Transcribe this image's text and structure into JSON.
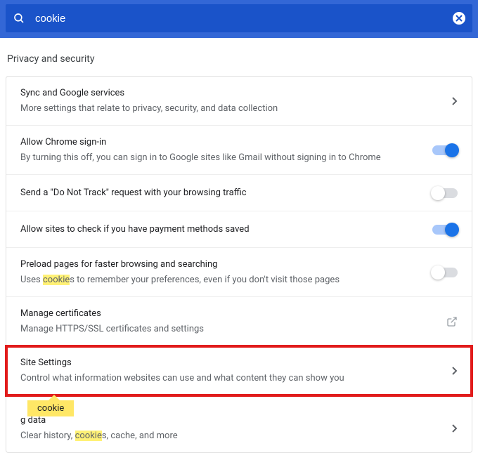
{
  "search": {
    "value": "cookie"
  },
  "section_title": "Privacy and security",
  "tooltip_text": "cookie",
  "rows": [
    {
      "title": "Sync and Google services",
      "desc": "More settings that relate to privacy, security, and data collection"
    },
    {
      "title": "Allow Chrome sign-in",
      "desc": "By turning this off, you can sign in to Google sites like Gmail without signing in to Chrome"
    },
    {
      "title": "Send a \"Do Not Track\" request with your browsing traffic"
    },
    {
      "title": "Allow sites to check if you have payment methods saved"
    },
    {
      "title": "Preload pages for faster browsing and searching",
      "desc_pre": "Uses ",
      "desc_hl": "cookie",
      "desc_post": "s to remember your preferences, even if you don't visit those pages"
    },
    {
      "title": "Manage certificates",
      "desc": "Manage HTTPS/SSL certificates and settings"
    },
    {
      "title": "Site Settings",
      "desc": "Control what information websites can use and what content they can show you"
    },
    {
      "title_post": "g data",
      "desc_pre": "Clear history, ",
      "desc_hl": "cookie",
      "desc_post": "s, cache, and more"
    }
  ]
}
